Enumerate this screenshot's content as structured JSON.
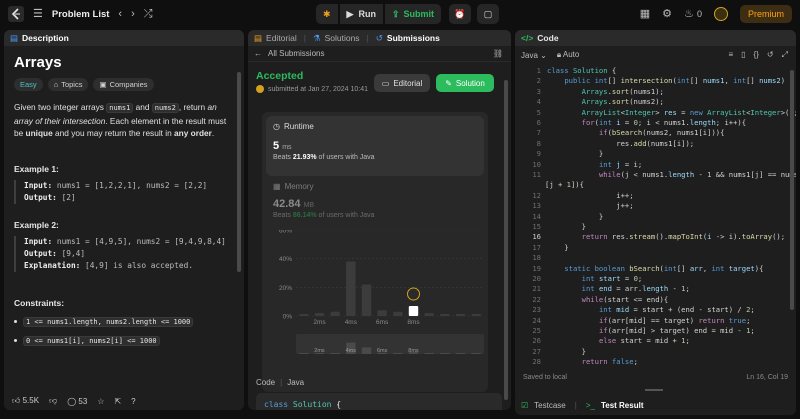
{
  "topbar": {
    "title": "Problem List",
    "run_label": "Run",
    "submit_label": "Submit",
    "streak": "0",
    "premium": "Premium"
  },
  "left": {
    "tab": "Description",
    "title": "Arrays",
    "tags": [
      "Easy",
      "Topics",
      "Companies"
    ],
    "desc": {
      "p1": "Given two integer arrays ",
      "c1": "nums1",
      "p2": " and ",
      "c2": "nums2",
      "p3": ", return ",
      "em1": "an array of their intersection",
      "p4": ". Each element in the result must be ",
      "b1": "unique",
      "p5": " and you may return the result in ",
      "b2": "any order",
      "p6": "."
    },
    "ex1": {
      "heading": "Example 1:",
      "input_label": "Input:",
      "input": "nums1 = [1,2,2,1], nums2 = [2,2]",
      "output_label": "Output:",
      "output": "[2]"
    },
    "ex2": {
      "heading": "Example 2:",
      "input_label": "Input:",
      "input": "nums1 = [4,9,5], nums2 = [9,4,9,8,4]",
      "output_label": "Output:",
      "output": "[9,4]",
      "expl_label": "Explanation:",
      "expl": "[4,9] is also accepted."
    },
    "constraints_heading": "Constraints:",
    "constraints": [
      "1 <= nums1.length, nums2.length <= 1000",
      "0 <= nums1[i], nums2[i] <= 1000"
    ],
    "likes": "5.5K",
    "comments": "53"
  },
  "mid": {
    "tabs": [
      "Editorial",
      "Solutions",
      "Submissions"
    ],
    "back_label": "All Submissions",
    "status": "Accepted",
    "submitted": "submitted at Jan 27, 2024 10:41",
    "editorial_btn": "Editorial",
    "solution_btn": "Solution",
    "runtime_label": "Runtime",
    "runtime_value": "5",
    "runtime_unit": "ms",
    "runtime_beats_pre": "Beats ",
    "runtime_beats": "21.93%",
    "runtime_beats_post": " of users with Java",
    "memory_label": "Memory",
    "memory_value": "42.84",
    "memory_unit": "MB",
    "memory_beats_pre": "Beats ",
    "memory_beats": "86.14%",
    "memory_beats_post": " of users with Java",
    "code_label": "Code",
    "code_lang": "Java",
    "code_first_line": "class Solution {"
  },
  "chart_data": {
    "type": "bar",
    "ytick_labels": [
      "60%",
      "40%",
      "20%",
      "0%"
    ],
    "xtick_labels": [
      "2ms",
      "4ms",
      "6ms",
      "8ms"
    ],
    "yticks": [
      60,
      40,
      20,
      0
    ],
    "ylim": [
      0,
      60
    ],
    "values": [
      1,
      2,
      3,
      38,
      22,
      4,
      3,
      7,
      2,
      1,
      1,
      1
    ],
    "highlight_index": 7,
    "overview_xtick_labels": [
      "2ms",
      "4ms",
      "6ms",
      "8ms"
    ]
  },
  "right": {
    "tab": "Code",
    "lang": "Java",
    "auto": "Auto",
    "saved": "Saved to local",
    "cursor": "Ln 16, Col 19",
    "bottom_tab1": "Testcase",
    "bottom_tab2": "Test Result"
  }
}
